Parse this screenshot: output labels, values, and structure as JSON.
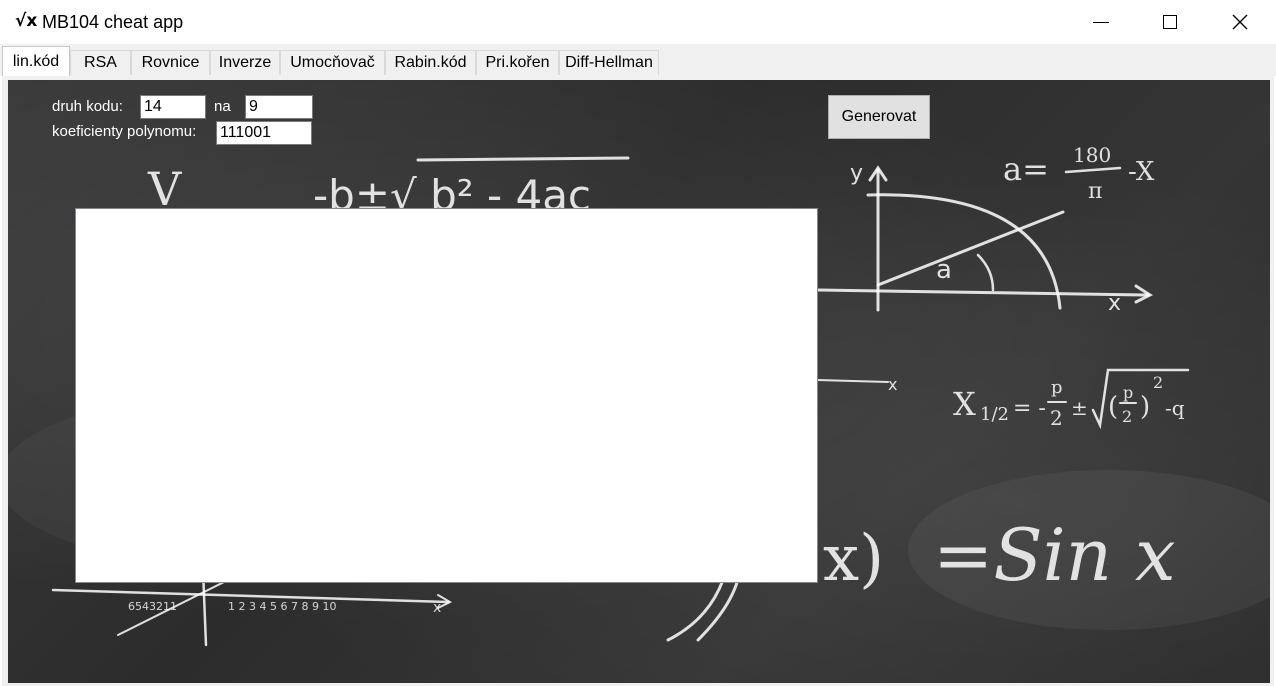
{
  "window": {
    "icon_glyph": "√x",
    "title": "MB104 cheat app",
    "close_glyph": "✕"
  },
  "tabs": [
    {
      "label": "lin.kód",
      "active": true
    },
    {
      "label": "RSA"
    },
    {
      "label": "Rovnice"
    },
    {
      "label": "Inverze"
    },
    {
      "label": "Umocňovač"
    },
    {
      "label": "Rabin.kód"
    },
    {
      "label": "Pri.kořen"
    },
    {
      "label": "Diff-Hellman"
    }
  ],
  "form": {
    "code_type_label": "druh kodu:",
    "code_type_value": "14",
    "na_label": "na",
    "na_value": "9",
    "poly_label": "koeficienty polynomu:",
    "poly_value": "111001",
    "generate_button": "Generovat"
  },
  "output": {
    "text": ""
  },
  "background": {
    "description": "chalkboard",
    "formulas": [
      "-b ± √ b² - 4ac",
      "a = 180/π - x",
      "x1/2 = -p/2 ± √((p/2)² - q)",
      "= Sin x"
    ]
  },
  "colors": {
    "chalkboard": "#2f2f2f",
    "chalk": "#ffffff",
    "tab_strip": "#f0f0f0",
    "button": "#e1e1e1"
  }
}
